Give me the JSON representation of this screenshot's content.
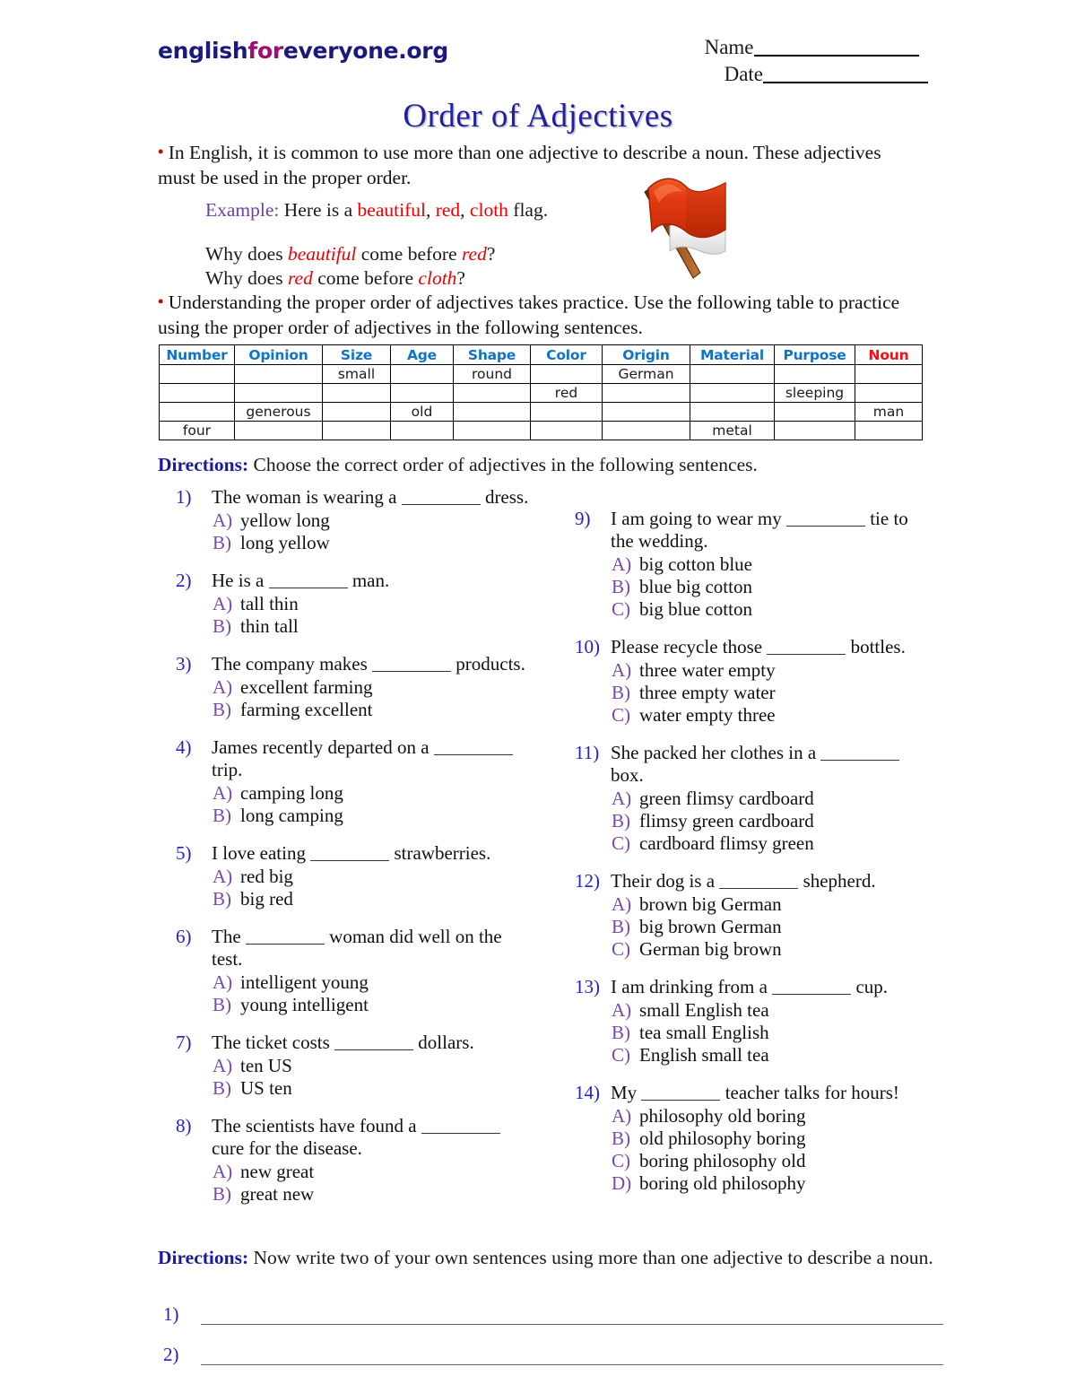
{
  "header": {
    "logo": {
      "english": "english",
      "for": "for",
      "everyone": "everyone",
      "org": ".org"
    },
    "name_label": "Name",
    "date_label": "Date"
  },
  "title": "Order of Adjectives",
  "intro": {
    "bullet": "•",
    "text": "In English, it is common to use more than one adjective to describe a noun. These adjectives must be used in the proper order."
  },
  "example": {
    "label": "Example:",
    "lead": "Here is a ",
    "adj1": "beautiful",
    "sep1": ", ",
    "adj2": "red",
    "sep2": ", ",
    "adj3": "cloth",
    "tail": " flag.",
    "q1_a": "Why does ",
    "q1_b": "beautiful",
    "q1_c": " come before ",
    "q1_d": "red",
    "q1_e": "?",
    "q2_a": "Why does ",
    "q2_b": "red",
    "q2_c": " come before ",
    "q2_d": "cloth",
    "q2_e": "?"
  },
  "practice": {
    "bullet": "•",
    "text": "Understanding the proper order of adjectives takes practice. Use the following table to practice using the proper order of adjectives in the following sentences."
  },
  "flag_image": {
    "icon": "red-flag-icon"
  },
  "table": {
    "headers": [
      "Number",
      "Opinion",
      "Size",
      "Age",
      "Shape",
      "Color",
      "Origin",
      "Material",
      "Purpose",
      "Noun"
    ],
    "header_colors": {
      "default": "#0f74c8",
      "noun": "#f41010"
    },
    "rows": [
      [
        "",
        "",
        "small",
        "",
        "round",
        "",
        "German",
        "",
        "",
        ""
      ],
      [
        "",
        "",
        "",
        "",
        "",
        "red",
        "",
        "",
        "sleeping",
        ""
      ],
      [
        "",
        "generous",
        "",
        "old",
        "",
        "",
        "",
        "",
        "",
        "man"
      ],
      [
        "four",
        "",
        "",
        "",
        "",
        "",
        "",
        "metal",
        "",
        ""
      ]
    ]
  },
  "directions_1": {
    "label": "Directions:",
    "text": "Choose the correct order of adjectives in the following sentences."
  },
  "questions_left": [
    {
      "number": "1)",
      "text_before": "The woman is wearing a ",
      "text_after": " dress.",
      "choices": [
        {
          "letter": "A)",
          "text": "yellow long"
        },
        {
          "letter": "B)",
          "text": "long yellow"
        }
      ]
    },
    {
      "number": "2)",
      "text_before": "He is a ",
      "text_after": " man.",
      "choices": [
        {
          "letter": "A)",
          "text": "tall thin"
        },
        {
          "letter": "B)",
          "text": "thin tall"
        }
      ]
    },
    {
      "number": "3)",
      "text_before": "The company makes ",
      "text_after": " products.",
      "choices": [
        {
          "letter": "A)",
          "text": "excellent farming"
        },
        {
          "letter": "B)",
          "text": "farming excellent"
        }
      ]
    },
    {
      "number": "4)",
      "text_before": "James recently departed on a ",
      "text_after": " trip.",
      "choices": [
        {
          "letter": "A)",
          "text": "camping long"
        },
        {
          "letter": "B)",
          "text": " long camping"
        }
      ]
    },
    {
      "number": "5)",
      "text_before": "I love eating ",
      "text_after": " strawberries.",
      "choices": [
        {
          "letter": "A)",
          "text": "red big"
        },
        {
          "letter": "B)",
          "text": "big red"
        }
      ]
    },
    {
      "number": "6)",
      "text_before": "The ",
      "text_after": " woman did well on the test.",
      "choices": [
        {
          "letter": "A)",
          "text": "intelligent young"
        },
        {
          "letter": "B)",
          "text": "young intelligent"
        }
      ]
    },
    {
      "number": "7)",
      "text_before": "The ticket costs ",
      "text_after": " dollars.",
      "choices": [
        {
          "letter": "A)",
          "text": "ten US"
        },
        {
          "letter": "B)",
          "text": "US ten"
        }
      ]
    },
    {
      "number": "8)",
      "text_before": "The scientists have found a ",
      "text_after": " cure for the disease.",
      "choices": [
        {
          "letter": "A)",
          "text": "new great"
        },
        {
          "letter": "B)",
          "text": "great new"
        }
      ]
    }
  ],
  "questions_right": [
    {
      "number": "9)",
      "text_before": "I am going to wear my ",
      "text_after": " tie to the wedding.",
      "choices": [
        {
          "letter": "A)",
          "text": "big cotton blue"
        },
        {
          "letter": "B)",
          "text": "blue big cotton"
        },
        {
          "letter": "C)",
          "text": "big blue cotton"
        }
      ]
    },
    {
      "number": "10)",
      "text_before": "Please recycle those ",
      "text_after": " bottles.",
      "choices": [
        {
          "letter": "A)",
          "text": "three water empty"
        },
        {
          "letter": "B)",
          "text": "three empty water"
        },
        {
          "letter": "C)",
          "text": "water empty three"
        }
      ]
    },
    {
      "number": "11)",
      "text_before": "She packed her clothes in a ",
      "text_after": " box.",
      "choices": [
        {
          "letter": "A)",
          "text": "green flimsy cardboard"
        },
        {
          "letter": "B)",
          "text": "flimsy green cardboard"
        },
        {
          "letter": "C)",
          "text": "cardboard flimsy green"
        }
      ]
    },
    {
      "number": "12)",
      "text_before": "Their dog is a ",
      "text_after": " shepherd.",
      "choices": [
        {
          "letter": "A)",
          "text": "brown big German"
        },
        {
          "letter": "B)",
          "text": "big brown German"
        },
        {
          "letter": "C)",
          "text": "German big brown"
        }
      ]
    },
    {
      "number": "13)",
      "text_before": "I am drinking from a ",
      "text_after": " cup.",
      "choices": [
        {
          "letter": "A)",
          "text": "small English tea"
        },
        {
          "letter": "B)",
          "text": "tea small English"
        },
        {
          "letter": "C)",
          "text": "English small tea"
        }
      ]
    },
    {
      "number": "14)",
      "text_before": "My ",
      "text_after": " teacher talks for hours!",
      "choices": [
        {
          "letter": "A)",
          "text": "philosophy old boring"
        },
        {
          "letter": "B)",
          "text": "old philosophy boring"
        },
        {
          "letter": "C)",
          "text": "boring philosophy old"
        },
        {
          "letter": "D)",
          "text": "boring old philosophy"
        }
      ]
    }
  ],
  "directions_2": {
    "label": "Directions:",
    "text": "Now write two of your own sentences using more than one adjective to describe a noun."
  },
  "own_sentences": [
    {
      "number": "1)",
      "value": ""
    },
    {
      "number": "2)",
      "value": ""
    }
  ]
}
